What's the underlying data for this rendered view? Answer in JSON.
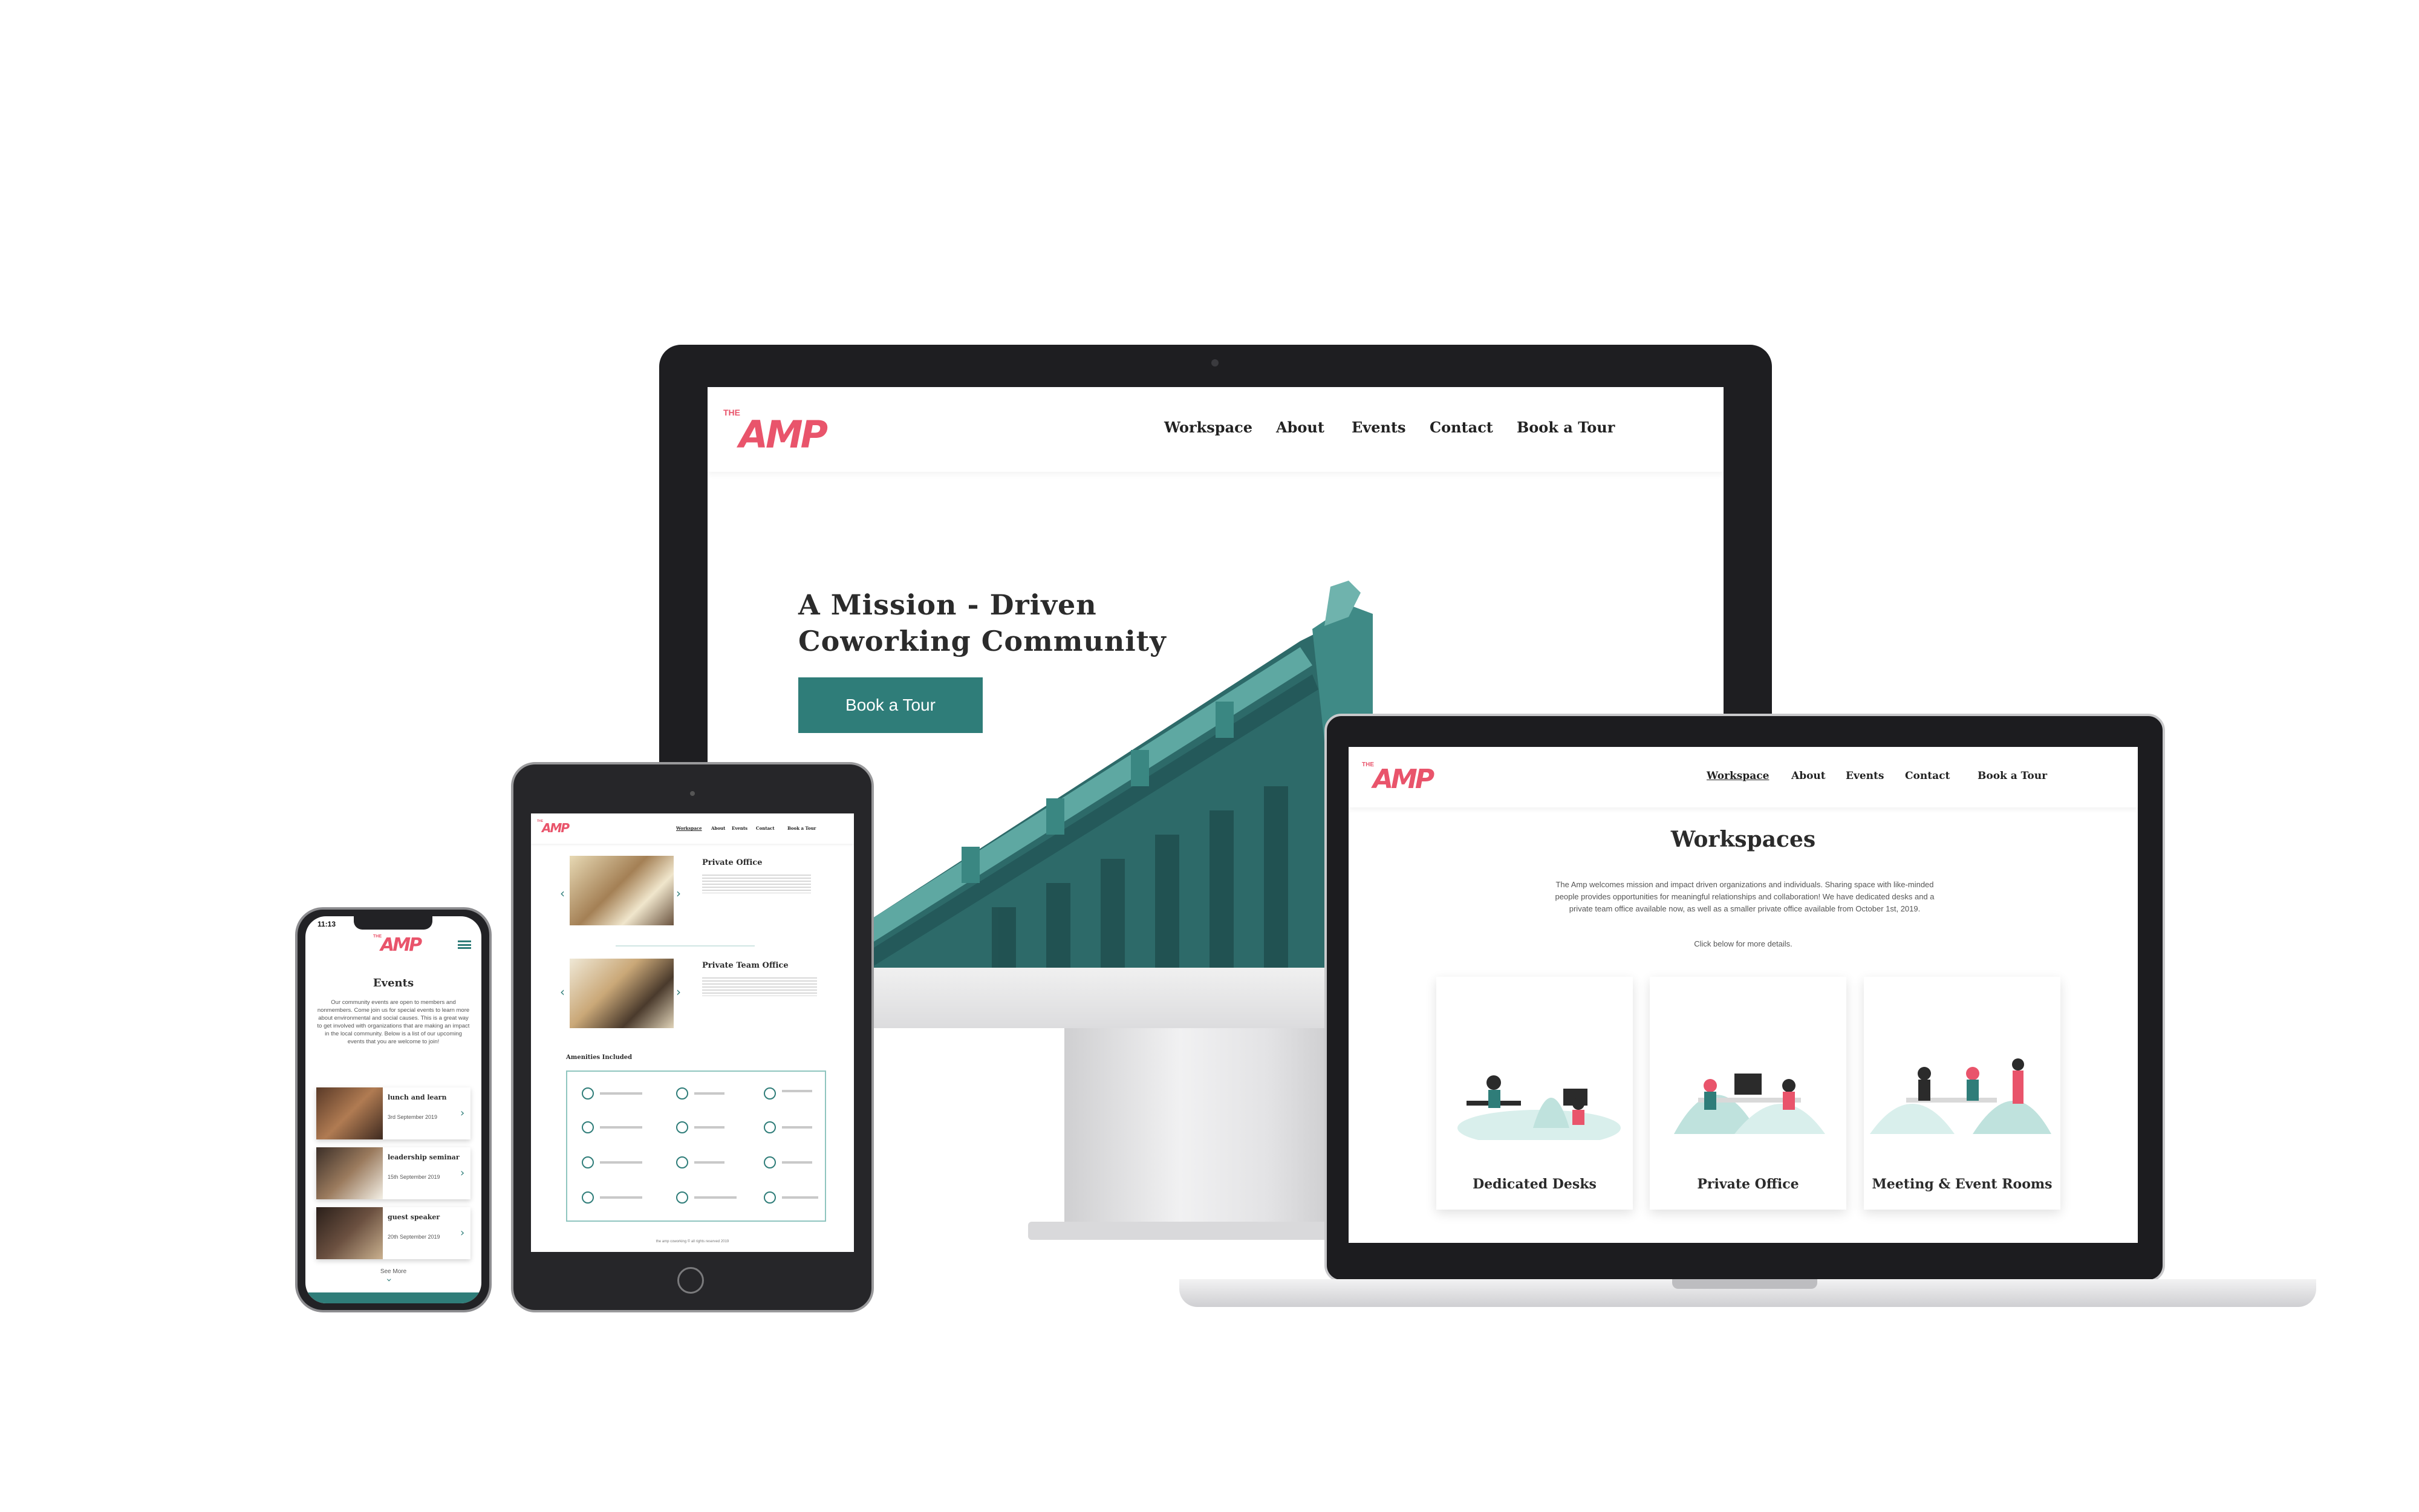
{
  "brand": {
    "logo_small": "THE",
    "logo_big": "AMP",
    "accent": "#e9546b",
    "teal": "#2f7d79",
    "frame": "#222225"
  },
  "nav": {
    "workspace": "Workspace",
    "about": "About",
    "events": "Events",
    "contact": "Contact",
    "book": "Book a Tour"
  },
  "desktop": {
    "headline_line1": "A Mission - Driven",
    "headline_line2": "Coworking Community",
    "cta": "Book a Tour"
  },
  "laptop": {
    "title": "Workspaces",
    "intro": "The Amp welcomes mission and impact driven organizations and individuals. Sharing space with like-minded people provides opportunities for meaningful relationships and collaboration! We have dedicated desks and a private team office available now, as well as a smaller private office available from October 1st, 2019.",
    "click_note": "Click below for more details.",
    "cards": [
      {
        "label": "Dedicated Desks"
      },
      {
        "label": "Private Office"
      },
      {
        "label": "Meeting & Event Rooms"
      }
    ]
  },
  "tablet": {
    "office1_title": "Private Office",
    "office2_title": "Private Team Office",
    "amenities_title": "Amenities Included",
    "footer": "the amp coworking © all rights reserved 2019"
  },
  "phone": {
    "time": "11:13",
    "title": "Events",
    "intro": "Our community events are open to members and nonmembers. Come join us for special events to learn more about environmental and social causes. This is a great way to get involved with organizations that are making an impact in the local community. Below is a list of our upcoming events that you are welcome to join!",
    "events": [
      {
        "name": "lunch and learn",
        "date": "3rd September 2019"
      },
      {
        "name": "leadership seminar",
        "date": "15th September 2019"
      },
      {
        "name": "guest speaker",
        "date": "20th September 2019"
      }
    ],
    "see_more": "See More"
  }
}
